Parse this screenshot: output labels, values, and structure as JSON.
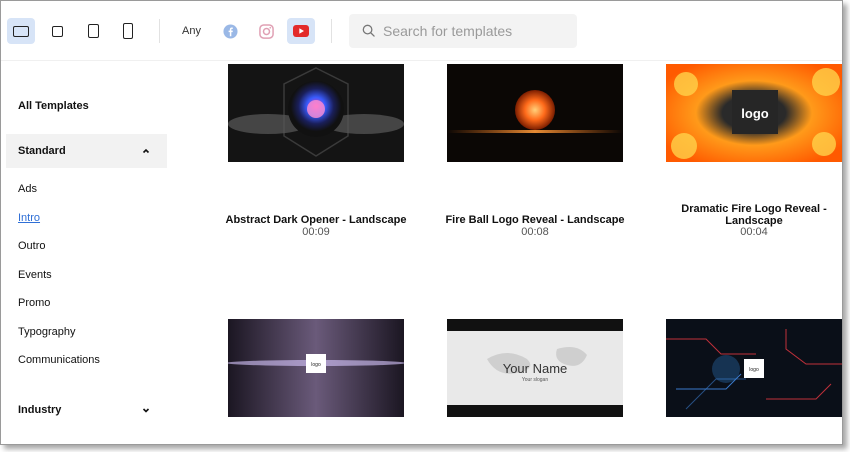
{
  "toolbar": {
    "formats": [
      {
        "icon": "landscape-format-icon",
        "active": true
      },
      {
        "icon": "square-format-icon",
        "active": false
      },
      {
        "icon": "portrait-format-icon",
        "active": false
      },
      {
        "icon": "vertical-format-icon",
        "active": false
      }
    ],
    "any_label": "Any",
    "platforms": [
      {
        "icon": "facebook-icon",
        "color": "#9ab8e6"
      },
      {
        "icon": "instagram-icon",
        "color": "#e0a0b4"
      },
      {
        "icon": "youtube-icon",
        "color": "#e32a2a",
        "active": true
      }
    ],
    "search_placeholder": "Search for templates"
  },
  "sidebar": {
    "all_templates": "All Templates",
    "standard": {
      "label": "Standard",
      "expanded": true,
      "items": [
        "Ads",
        "Intro",
        "Outro",
        "Events",
        "Promo",
        "Typography",
        "Communications"
      ],
      "active_item": "Intro"
    },
    "industry": {
      "label": "Industry",
      "expanded": false
    }
  },
  "templates": [
    {
      "title": "Abstract Dark Opener - Landscape",
      "duration": "00:09"
    },
    {
      "title": "Fire Ball Logo Reveal - Landscape",
      "duration": "00:08"
    },
    {
      "title": "Dramatic Fire Logo Reveal - Landscape",
      "duration": "00:04",
      "thumb_text": "logo"
    },
    {
      "title": "",
      "duration": "",
      "thumb_text": "logo"
    },
    {
      "title": "",
      "duration": "",
      "thumb_text": "Your Name",
      "thumb_subtext": "Your slogan"
    },
    {
      "title": "",
      "duration": "",
      "thumb_text": "logo"
    }
  ],
  "colors": {
    "accent": "#2f6fd6",
    "active_format_bg": "#d7e4f7"
  }
}
